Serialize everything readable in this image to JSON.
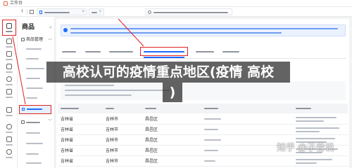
{
  "topbar": {
    "workbench_label": "工作台"
  },
  "sidebar": {
    "heading": "商品",
    "group_label": "商品管理"
  },
  "overlay": {
    "line1": "高校认可的疫情重点地区(疫情 高校",
    "line2": ")"
  },
  "table": {
    "rows": [
      [
        "吉林省",
        "吉林市",
        "昌邑区"
      ],
      [
        "吉林省",
        "吉林市",
        "昌邑区"
      ],
      [
        "吉林省",
        "吉林市",
        "昌邑区"
      ],
      [
        "吉林省",
        "吉林市",
        "昌邑区"
      ],
      [
        "吉林省",
        "吉林市",
        "昌邑区"
      ]
    ]
  },
  "watermark": {
    "text": "知乎 @子音说"
  },
  "icons": {
    "rail": [
      "bag-icon",
      "clipboard-icon",
      "box-icon",
      "store-icon",
      "coin-icon",
      "chart-icon",
      "megaphone-icon",
      "user-icon",
      "grid-icon",
      "gear-icon"
    ],
    "tabstrip": [
      "chevron-left-icon",
      "home-icon",
      "close-icon",
      "info-icon"
    ]
  },
  "colors": {
    "accent": "#1f6bff",
    "annotation": "#e02020",
    "banner_bg": "#eaf2ff"
  }
}
